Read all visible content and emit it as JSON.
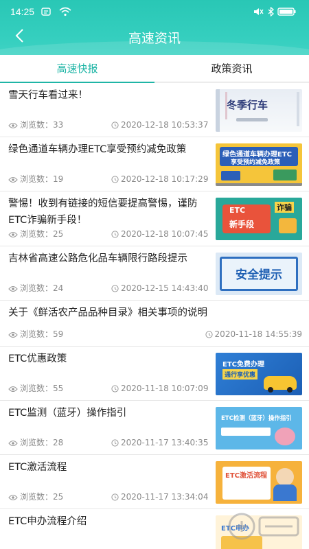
{
  "status": {
    "time": "14:25"
  },
  "header": {
    "title": "高速资讯"
  },
  "tabs": [
    {
      "label": "高速快报",
      "active": true
    },
    {
      "label": "政策资讯",
      "active": false
    }
  ],
  "labels": {
    "views": "浏览数："
  },
  "news": [
    {
      "title": "雪天行车看过来！",
      "views": "33",
      "date": "2020-12-18 10:53:37",
      "thumb_text": "冬季行车"
    },
    {
      "title": "绿色通道车辆办理ETC享受预约减免政策",
      "views": "19",
      "date": "2020-12-18 10:17:29",
      "thumb_text": "绿色通道车辆办理ETC",
      "thumb_text2": "享受预约减免政策"
    },
    {
      "title": "警惕！收到有链接的短信要提高警惕，谨防ETC诈骗新手段！",
      "views": "25",
      "date": "2020-12-18 10:07:45",
      "thumb_text": "ETC",
      "thumb_text2": "新手段",
      "thumb_text3": "诈骗"
    },
    {
      "title": "吉林省高速公路危化品车辆限行路段提示",
      "views": "24",
      "date": "2020-12-15 14:43:40",
      "thumb_text": "安全提示"
    },
    {
      "title": "关于《鲜活农产品品种目录》相关事项的说明",
      "views": "59",
      "date": "2020-11-18 14:55:39"
    },
    {
      "title": "ETC优惠政策",
      "views": "55",
      "date": "2020-11-18 10:07:09",
      "thumb_text": "ETC免费办理",
      "thumb_text2": "通行享优惠"
    },
    {
      "title": "ETC监测（蓝牙）操作指引",
      "views": "28",
      "date": "2020-11-17 13:40:35",
      "thumb_text": "ETC检测（蓝牙）操作指引"
    },
    {
      "title": "ETC激活流程",
      "views": "25",
      "date": "2020-11-17 13:34:04",
      "thumb_text": "ETC激活流程"
    },
    {
      "title": "ETC申办流程介绍",
      "views": "",
      "date": "",
      "thumb_text": "ETC申办"
    }
  ],
  "colors": {
    "accent": "#1fb5a6",
    "header": "#35cfbf"
  }
}
